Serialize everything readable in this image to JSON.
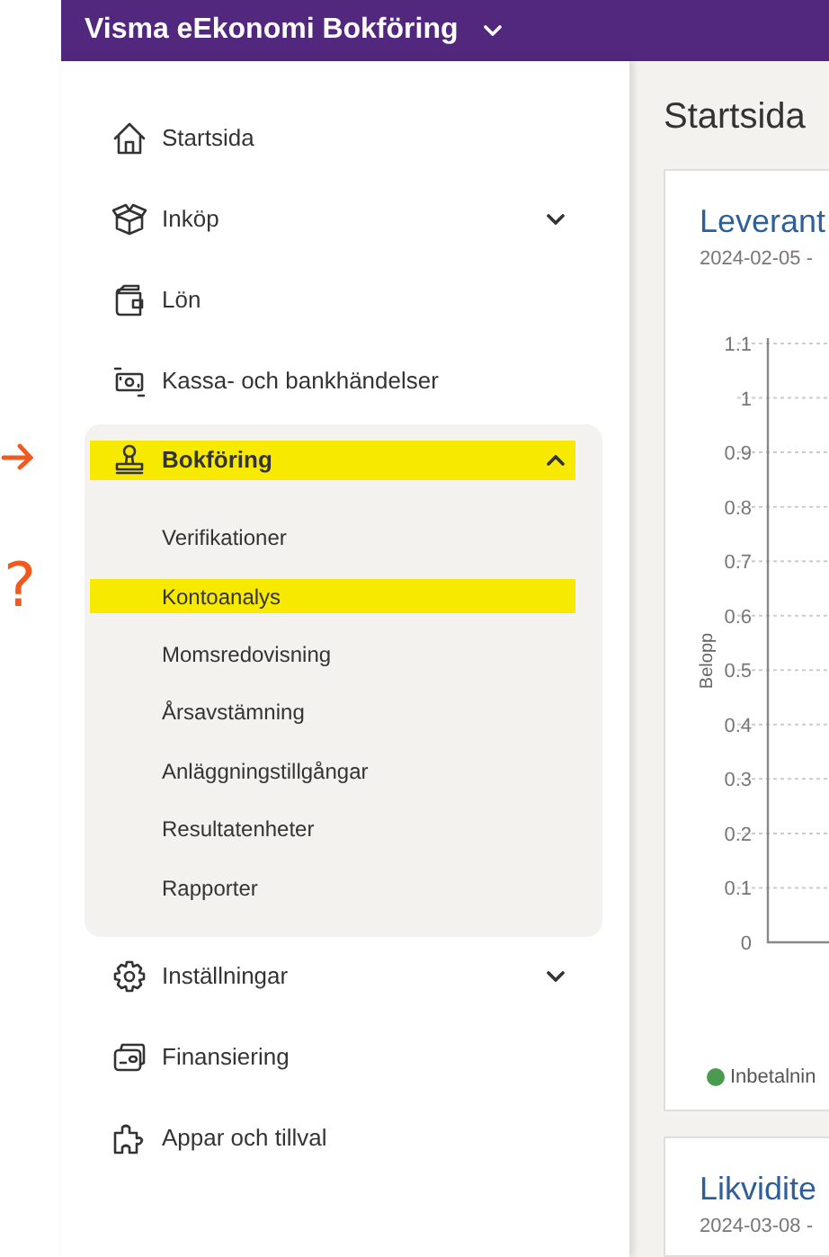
{
  "topbar": {
    "title": "Visma eEkonomi Bokföring"
  },
  "sidebar": {
    "items": [
      {
        "label": "Startsida"
      },
      {
        "label": "Inköp",
        "expanded": false
      },
      {
        "label": "Lön"
      },
      {
        "label": "Kassa- och bankhändelser"
      },
      {
        "label": "Bokföring",
        "expanded": true,
        "highlighted": true,
        "children": [
          {
            "label": "Verifikationer",
            "highlighted": false
          },
          {
            "label": "Kontoanalys",
            "highlighted": true
          },
          {
            "label": "Momsredovisning",
            "highlighted": false
          },
          {
            "label": "Årsavstämning",
            "highlighted": false
          },
          {
            "label": "Anläggningstillgångar",
            "highlighted": false
          },
          {
            "label": "Resultatenheter",
            "highlighted": false
          },
          {
            "label": "Rapporter",
            "highlighted": false
          }
        ]
      },
      {
        "label": "Inställningar",
        "expanded": false
      },
      {
        "label": "Finansiering"
      },
      {
        "label": "Appar och tillval"
      }
    ]
  },
  "main": {
    "title": "Startsida",
    "cards": [
      {
        "title": "Leverant",
        "date": "2024-02-05 -",
        "chart_data": {
          "type": "bar",
          "grid": true,
          "ylabel": "Belopp",
          "ylim": [
            0,
            1.1
          ],
          "yticks": [
            0,
            0.1,
            0.2,
            0.3,
            0.4,
            0.5,
            0.6,
            0.7,
            0.8,
            0.9,
            1,
            1.1
          ],
          "series": [
            {
              "name": "Inbetalnin",
              "color": "#4a9a50"
            }
          ]
        }
      },
      {
        "title": "Likvidite",
        "date": "2024-03-08 -"
      }
    ]
  },
  "annotations": {
    "arrow": true,
    "question_mark": "?"
  }
}
